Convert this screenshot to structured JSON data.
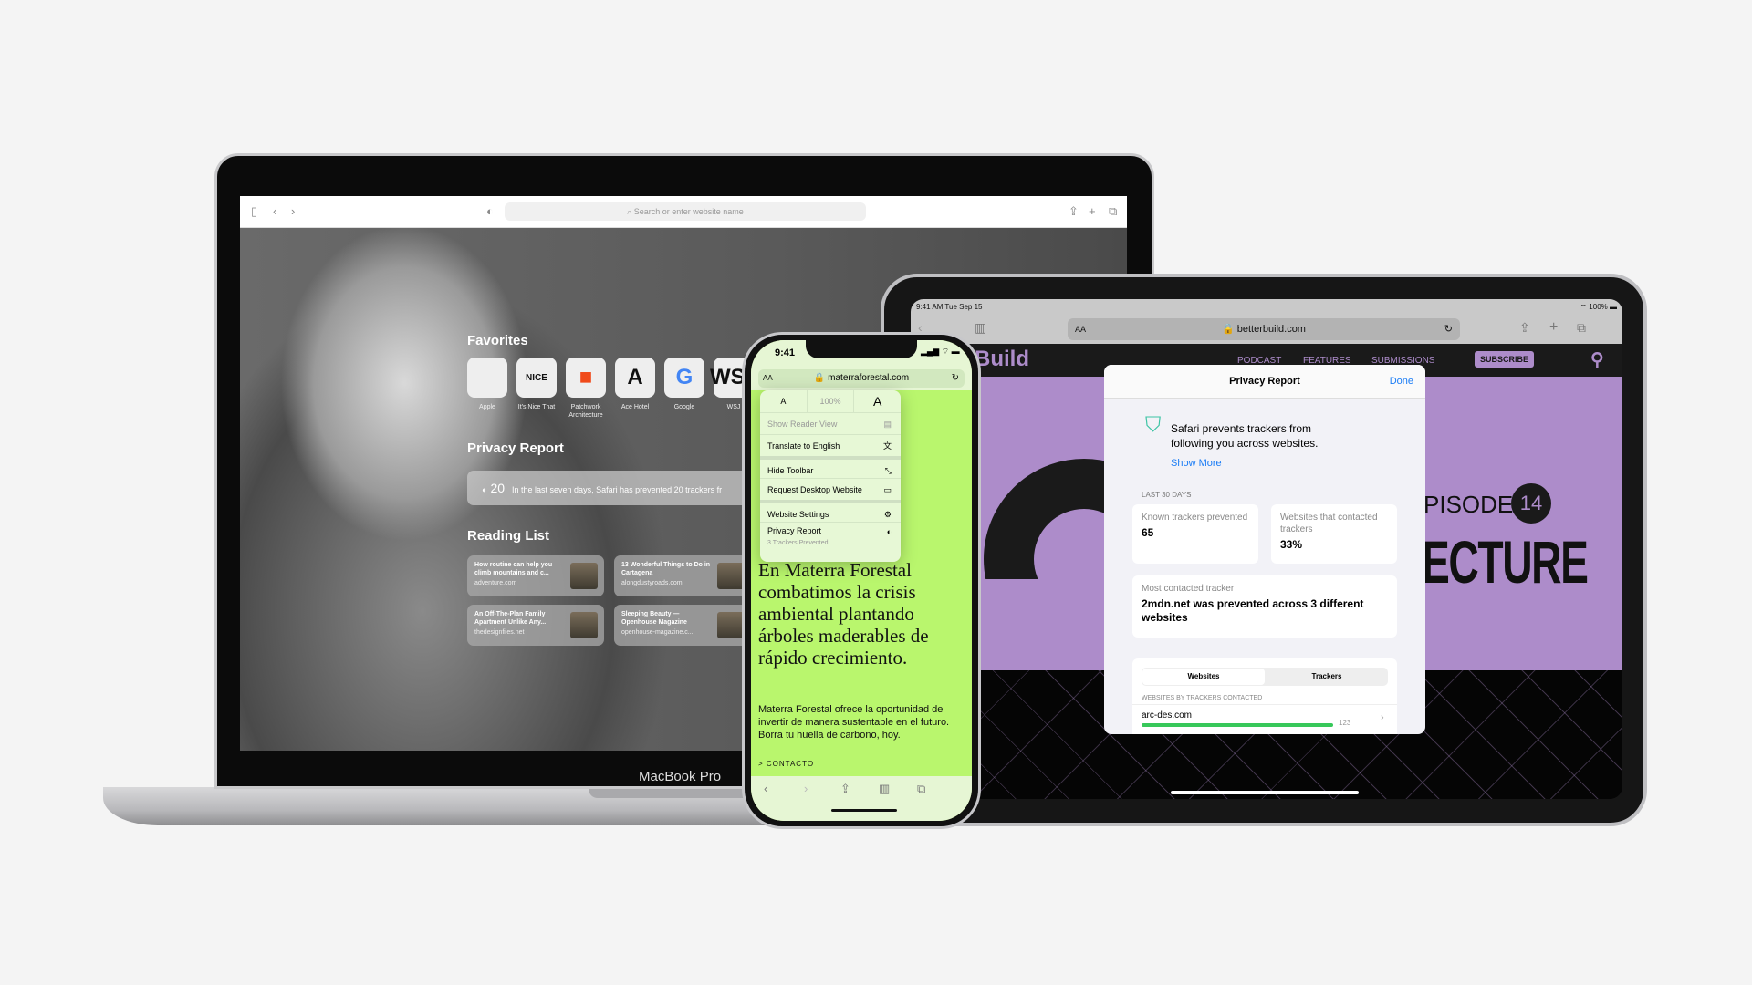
{
  "macbook": {
    "label": "MacBook Pro",
    "search_placeholder": "Search or enter website name",
    "favorites_title": "Favorites",
    "favorites": [
      {
        "label": "Apple",
        "glyph": "",
        "icon": "apple-logo"
      },
      {
        "label": "It's Nice That",
        "glyph": "NICE",
        "icon": "its-nice-that-logo"
      },
      {
        "label": "Patchwork Architecture",
        "glyph": "■",
        "icon": "patchwork-logo"
      },
      {
        "label": "Ace Hotel",
        "glyph": "A",
        "icon": "ace-hotel-logo"
      },
      {
        "label": "Google",
        "glyph": "G",
        "icon": "google-logo"
      },
      {
        "label": "WSJ",
        "glyph": "WSJ",
        "icon": "wsj-logo"
      }
    ],
    "privacy_title": "Privacy Report",
    "privacy_count": "20",
    "privacy_text": "In the last seven days, Safari has prevented 20 trackers fr",
    "reading_title": "Reading List",
    "reading_list": [
      {
        "title": "How routine can help you climb mountains and c...",
        "domain": "adventure.com"
      },
      {
        "title": "13 Wonderful Things to Do in Cartagena",
        "domain": "alongdustyroads.com"
      },
      {
        "title": "An Off-The-Plan Family Apartment Unlike Any...",
        "domain": "thedesignfiles.net"
      },
      {
        "title": "Sleeping Beauty — Openhouse Magazine",
        "domain": "openhouse-magazine.c..."
      }
    ]
  },
  "iphone": {
    "time": "9:41",
    "text_size_btn": "AA",
    "url": "materraforestal.com",
    "menu": {
      "small_a": "A",
      "zoom": "100%",
      "large_a": "A",
      "items": [
        {
          "label": "Show Reader View",
          "icon": "reader-icon"
        },
        {
          "label": "Translate to English",
          "icon": "translate-icon"
        },
        {
          "label": "Hide Toolbar",
          "icon": "resize-icon"
        },
        {
          "label": "Request Desktop Website",
          "icon": "desktop-icon"
        },
        {
          "label": "Website Settings",
          "icon": "settings-icon"
        },
        {
          "label": "Privacy Report",
          "sub": "3 Trackers Prevented",
          "icon": "shield-icon"
        }
      ]
    },
    "headline": "En Materra Forestal combatimos la crisis ambiental plantando árboles maderables de rápido crecimiento.",
    "body": "Materra Forestal ofrece la oportunidad de invertir de manera sustentable en el futuro. Borra tu huella de carbono, hoy.",
    "contact": "> CONTACTO"
  },
  "ipad": {
    "status_time": "9:41 AM  Tue Sep 15",
    "battery": "100%",
    "text_size_btn": "AA",
    "url": "betterbuild.com",
    "site_logo": "Build",
    "nav": [
      "PODCAST",
      "FEATURES",
      "SUBMISSIONS"
    ],
    "subscribe": "SUBSCRIBE",
    "episode": "PISODE",
    "episode_num": "14",
    "big_title": "ECTURE",
    "accent": "#ad8cca",
    "modal": {
      "title": "Privacy Report",
      "done": "Done",
      "intro": "Safari prevents trackers from following you across websites.",
      "show_more": "Show More",
      "period": "LAST 30 DAYS",
      "stat1_label": "Known trackers prevented",
      "stat1_value": "65",
      "stat2_label": "Websites that contacted trackers",
      "stat2_value": "33%",
      "most_label": "Most contacted tracker",
      "most_value": "2mdn.net was prevented across 3 different websites",
      "seg_websites": "Websites",
      "seg_trackers": "Trackers",
      "list_header": "WEBSITES BY TRACKERS CONTACTED",
      "row_site": "arc-des.com",
      "row_count": "123"
    }
  }
}
